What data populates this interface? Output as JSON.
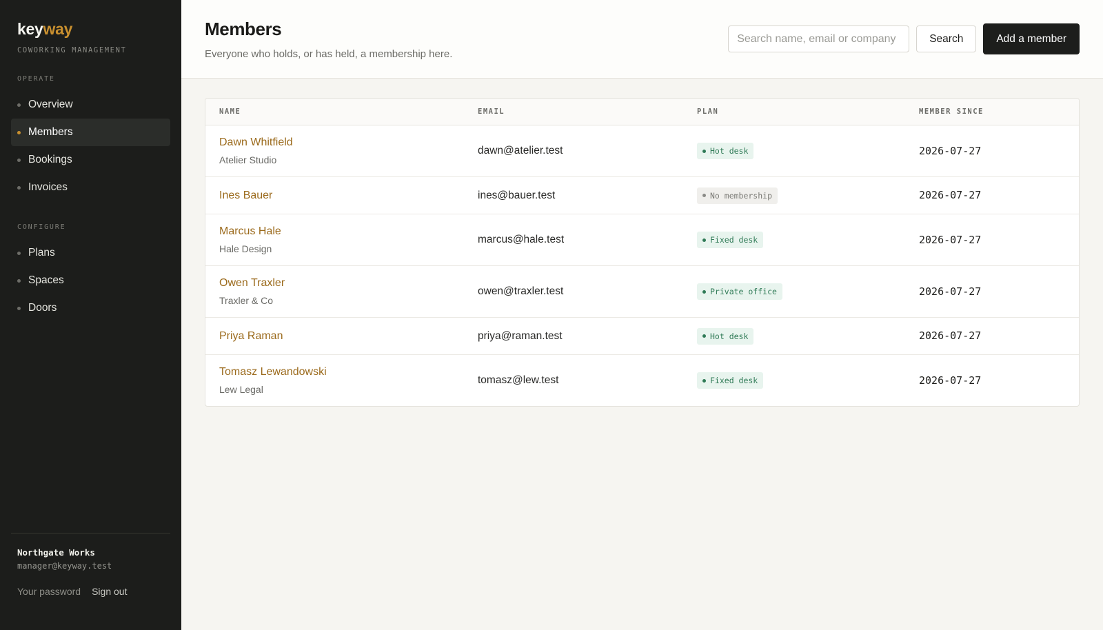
{
  "brand": {
    "logo_first": "key",
    "logo_second": "way",
    "tagline": "COWORKING MANAGEMENT"
  },
  "sidebar": {
    "operate_label": "OPERATE",
    "operate_items": [
      {
        "label": "Overview",
        "active": false
      },
      {
        "label": "Members",
        "active": true
      },
      {
        "label": "Bookings",
        "active": false
      },
      {
        "label": "Invoices",
        "active": false
      }
    ],
    "configure_label": "CONFIGURE",
    "configure_items": [
      {
        "label": "Plans",
        "active": false
      },
      {
        "label": "Spaces",
        "active": false
      },
      {
        "label": "Doors",
        "active": false
      }
    ],
    "footer": {
      "org_name": "Northgate Works",
      "org_email": "manager@keyway.test",
      "password_link": "Your password",
      "signout_link": "Sign out"
    }
  },
  "header": {
    "title": "Members",
    "subtitle": "Everyone who holds, or has held, a membership here.",
    "search_placeholder": "Search name, email or company",
    "search_value": "",
    "search_button": "Search",
    "add_button": "Add a member"
  },
  "colors": {
    "accent": "#c9902f",
    "link": "#9b6a1c",
    "plan_green": "#2f7a56",
    "sidebar_bg": "#1c1d1b"
  },
  "table": {
    "columns": {
      "name": "NAME",
      "email": "EMAIL",
      "plan": "PLAN",
      "since": "MEMBER SINCE"
    },
    "rows": [
      {
        "name": "Dawn Whitfield",
        "company": "Atelier Studio",
        "email": "dawn@atelier.test",
        "plan": "Hot desk",
        "plan_status": "active",
        "since": "2026-07-27"
      },
      {
        "name": "Ines Bauer",
        "company": "",
        "email": "ines@bauer.test",
        "plan": "No membership",
        "plan_status": "none",
        "since": "2026-07-27"
      },
      {
        "name": "Marcus Hale",
        "company": "Hale Design",
        "email": "marcus@hale.test",
        "plan": "Fixed desk",
        "plan_status": "active",
        "since": "2026-07-27"
      },
      {
        "name": "Owen Traxler",
        "company": "Traxler & Co",
        "email": "owen@traxler.test",
        "plan": "Private office",
        "plan_status": "active",
        "since": "2026-07-27"
      },
      {
        "name": "Priya Raman",
        "company": "",
        "email": "priya@raman.test",
        "plan": "Hot desk",
        "plan_status": "active",
        "since": "2026-07-27"
      },
      {
        "name": "Tomasz Lewandowski",
        "company": "Lew Legal",
        "email": "tomasz@lew.test",
        "plan": "Fixed desk",
        "plan_status": "active",
        "since": "2026-07-27"
      }
    ]
  }
}
